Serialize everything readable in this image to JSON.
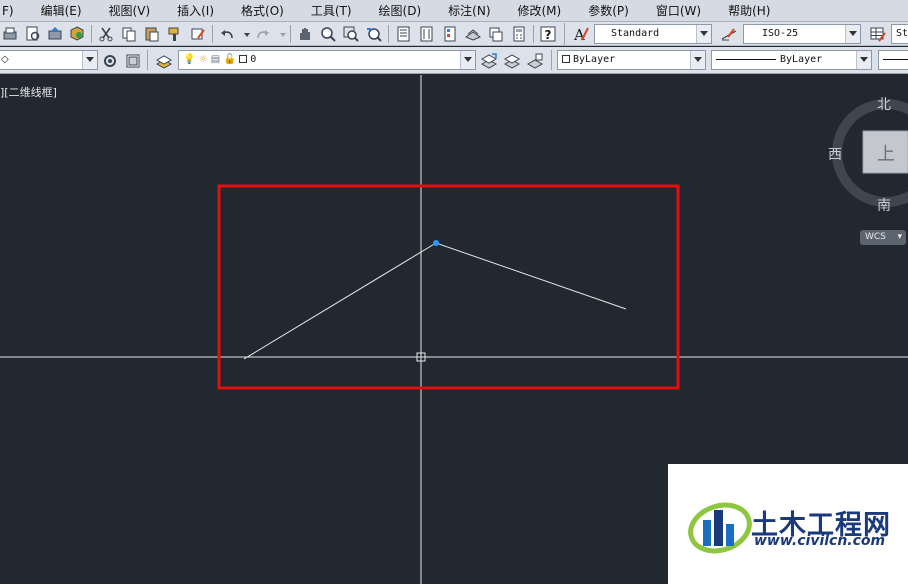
{
  "menubar": {
    "items": [
      "F)",
      "编辑(E)",
      "视图(V)",
      "插入(I)",
      "格式(O)",
      "工具(T)",
      "绘图(D)",
      "标注(N)",
      "修改(M)",
      "参数(P)",
      "窗口(W)",
      "帮助(H)"
    ]
  },
  "toolbar": {
    "text_style": "Standard",
    "dim_style": "ISO-25",
    "third_style": "St",
    "layer": "0",
    "color": "ByLayer",
    "linetype": "ByLayer"
  },
  "viewport": {
    "label": "][二维线框]"
  },
  "viewcube": {
    "north": "北",
    "west": "西",
    "south": "南",
    "top": "上",
    "ucs": "WCS"
  },
  "watermark": {
    "title": "土木工程网",
    "url": "www.civilcn.com"
  },
  "colors": {
    "canvas": "#212830",
    "highlight": "#e01010",
    "grip": "#2b9bff"
  }
}
